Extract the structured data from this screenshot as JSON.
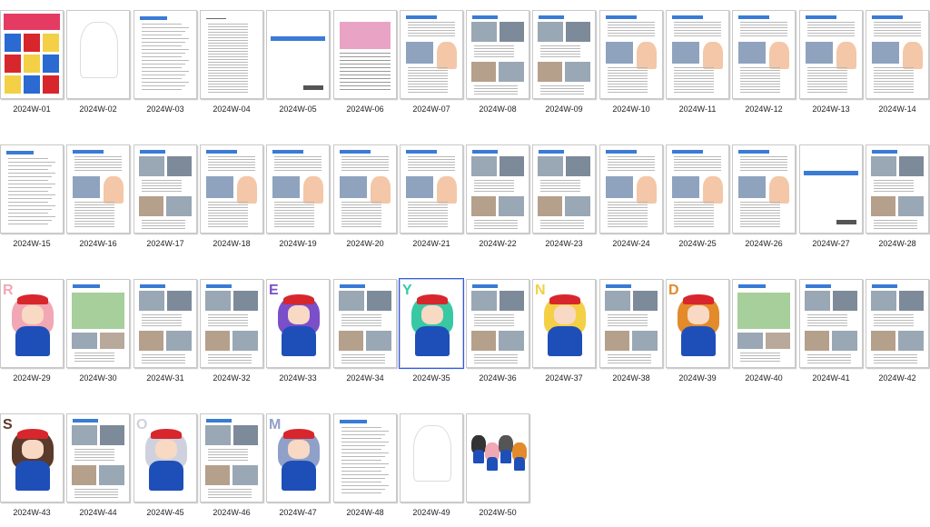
{
  "colors": {
    "accent_blue": "#3a7bd5",
    "uniform_blue": "#1e4fb8",
    "cap_red": "#d8262d",
    "selection_border": "#2b59ff"
  },
  "thumbnails": [
    {
      "label": "2024W-01",
      "kind": "cover"
    },
    {
      "label": "2024W-02",
      "kind": "sketch"
    },
    {
      "label": "2024W-03",
      "kind": "text"
    },
    {
      "label": "2024W-04",
      "kind": "toc"
    },
    {
      "label": "2024W-05",
      "kind": "banner"
    },
    {
      "label": "2024W-06",
      "kind": "table"
    },
    {
      "label": "2024W-07",
      "kind": "mixed"
    },
    {
      "label": "2024W-08",
      "kind": "photos"
    },
    {
      "label": "2024W-09",
      "kind": "photos"
    },
    {
      "label": "2024W-10",
      "kind": "mixed"
    },
    {
      "label": "2024W-11",
      "kind": "mixed"
    },
    {
      "label": "2024W-12",
      "kind": "mixed"
    },
    {
      "label": "2024W-13",
      "kind": "mixed"
    },
    {
      "label": "2024W-14",
      "kind": "mixed"
    },
    {
      "label": "2024W-15",
      "kind": "text"
    },
    {
      "label": "2024W-16",
      "kind": "mixed"
    },
    {
      "label": "2024W-17",
      "kind": "photos"
    },
    {
      "label": "2024W-18",
      "kind": "mixed"
    },
    {
      "label": "2024W-19",
      "kind": "mixed"
    },
    {
      "label": "2024W-20",
      "kind": "mixed"
    },
    {
      "label": "2024W-21",
      "kind": "mixed"
    },
    {
      "label": "2024W-22",
      "kind": "photos"
    },
    {
      "label": "2024W-23",
      "kind": "photos"
    },
    {
      "label": "2024W-24",
      "kind": "mixed"
    },
    {
      "label": "2024W-25",
      "kind": "mixed"
    },
    {
      "label": "2024W-26",
      "kind": "mixed"
    },
    {
      "label": "2024W-27",
      "kind": "banner"
    },
    {
      "label": "2024W-28",
      "kind": "photos"
    },
    {
      "label": "2024W-29",
      "kind": "character",
      "hair": "#f2a7b5",
      "letters": "R"
    },
    {
      "label": "2024W-30",
      "kind": "map"
    },
    {
      "label": "2024W-31",
      "kind": "photos"
    },
    {
      "label": "2024W-32",
      "kind": "photos"
    },
    {
      "label": "2024W-33",
      "kind": "character",
      "hair": "#7a4fc9",
      "letters": "E"
    },
    {
      "label": "2024W-34",
      "kind": "photos"
    },
    {
      "label": "2024W-35",
      "kind": "character",
      "hair": "#38c9a4",
      "letters": "Y"
    },
    {
      "label": "2024W-36",
      "kind": "photos"
    },
    {
      "label": "2024W-37",
      "kind": "character",
      "hair": "#f3d045",
      "letters": "N"
    },
    {
      "label": "2024W-38",
      "kind": "photos"
    },
    {
      "label": "2024W-39",
      "kind": "character",
      "hair": "#e38a2b",
      "letters": "D"
    },
    {
      "label": "2024W-40",
      "kind": "map"
    },
    {
      "label": "2024W-41",
      "kind": "photos"
    },
    {
      "label": "2024W-42",
      "kind": "photos"
    },
    {
      "label": "2024W-43",
      "kind": "character",
      "hair": "#5a3a2a",
      "letters": "S"
    },
    {
      "label": "2024W-44",
      "kind": "photos"
    },
    {
      "label": "2024W-45",
      "kind": "character",
      "hair": "#cfd2de",
      "letters": "O"
    },
    {
      "label": "2024W-46",
      "kind": "photos"
    },
    {
      "label": "2024W-47",
      "kind": "character",
      "hair": "#8fa0c9",
      "letters": "M"
    },
    {
      "label": "2024W-48",
      "kind": "text"
    },
    {
      "label": "2024W-49",
      "kind": "sketch"
    },
    {
      "label": "2024W-50",
      "kind": "group"
    }
  ]
}
